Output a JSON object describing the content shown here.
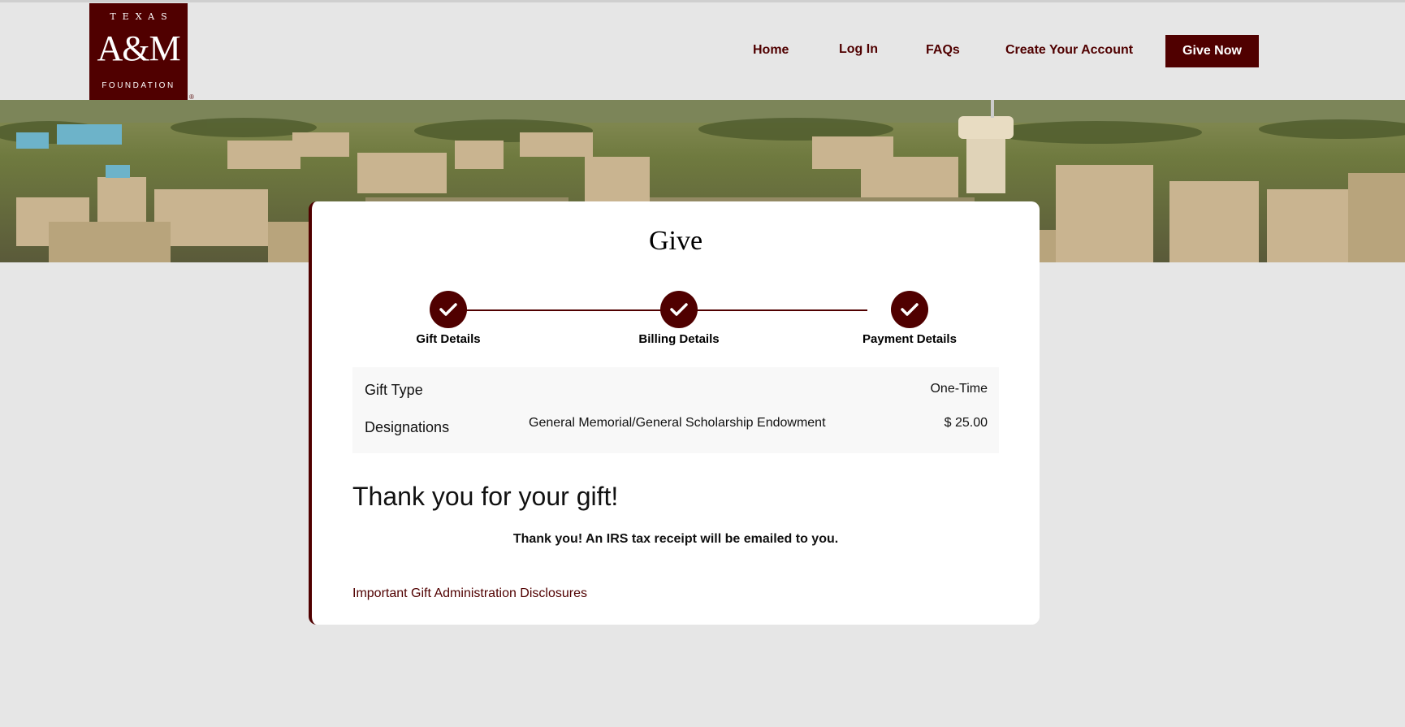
{
  "logo": {
    "line1": "TEXAS",
    "line2": "A&M",
    "line3": "FOUNDATION",
    "registered": "®",
    "color": "#500000"
  },
  "nav": {
    "home": "Home",
    "login": "Log In",
    "faqs": "FAQs",
    "create_account": "Create Your Account",
    "give_now": "Give Now"
  },
  "card": {
    "title": "Give",
    "steps": [
      {
        "label": "Gift Details",
        "status": "complete",
        "icon": "checkmark-icon"
      },
      {
        "label": "Billing Details",
        "status": "complete",
        "icon": "checkmark-icon"
      },
      {
        "label": "Payment Details",
        "status": "complete",
        "icon": "checkmark-icon"
      }
    ],
    "summary": {
      "gift_type_label": "Gift Type",
      "gift_type_value": "One-Time",
      "designations_label": "Designations",
      "designation_name": "General Memorial/General Scholarship Endowment",
      "designation_amount": "$ 25.00"
    },
    "thank_you_heading": "Thank you for your gift!",
    "thank_you_message": "Thank you! An IRS tax receipt will be emailed to you.",
    "disclosures_link": "Important Gift Administration Disclosures"
  },
  "colors": {
    "maroon": "#500000",
    "page_bg": "#e6e6e6",
    "card_bg": "#ffffff"
  }
}
